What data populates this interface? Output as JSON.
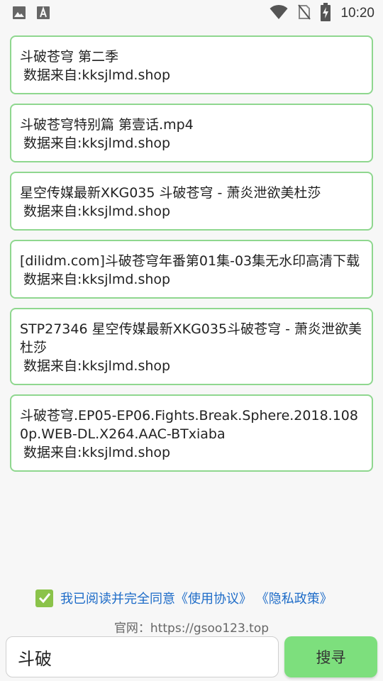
{
  "status_bar": {
    "time": "10:20",
    "left_icons": [
      "image-icon",
      "text-a-icon"
    ],
    "right_icons": [
      "wifi-icon",
      "no-sim-icon",
      "battery-charging-icon"
    ]
  },
  "results": [
    {
      "title": "斗破苍穹 第二季",
      "source": "数据来自:kksjlmd.shop"
    },
    {
      "title": "斗破苍穹特别篇 第壹话.mp4",
      "source": "数据来自:kksjlmd.shop"
    },
    {
      "title": "星空传媒最新XKG035 斗破苍穹 - 萧炎泄欲美杜莎",
      "source": "数据来自:kksjlmd.shop"
    },
    {
      "title": "[dilidm.com]斗破苍穹年番第01集-03集无水印高清下载",
      "source": "数据来自:kksjlmd.shop"
    },
    {
      "title": "STP27346 星空传媒最新XKG035斗破苍穹 - 萧炎泄欲美杜莎",
      "source": "数据来自:kksjlmd.shop"
    },
    {
      "title": "斗破苍穹.EP05-EP06.Fights.Break.Sphere.2018.1080p.WEB-DL.X264.AAC-BTxiaba",
      "source": "数据来自:kksjlmd.shop"
    }
  ],
  "agreement": {
    "checked": true,
    "text": "我已阅读并完全同意",
    "user_agreement": "《使用协议》",
    "privacy_policy": "《隐私政策》"
  },
  "website": "官网：https://gsoo123.top",
  "search": {
    "value": "斗破",
    "button_label": "搜寻"
  },
  "colors": {
    "card_border": "#8fd78f",
    "button_bg": "#7ddf7d",
    "checkbox": "#8bc34a",
    "link": "#1e6cc8"
  }
}
